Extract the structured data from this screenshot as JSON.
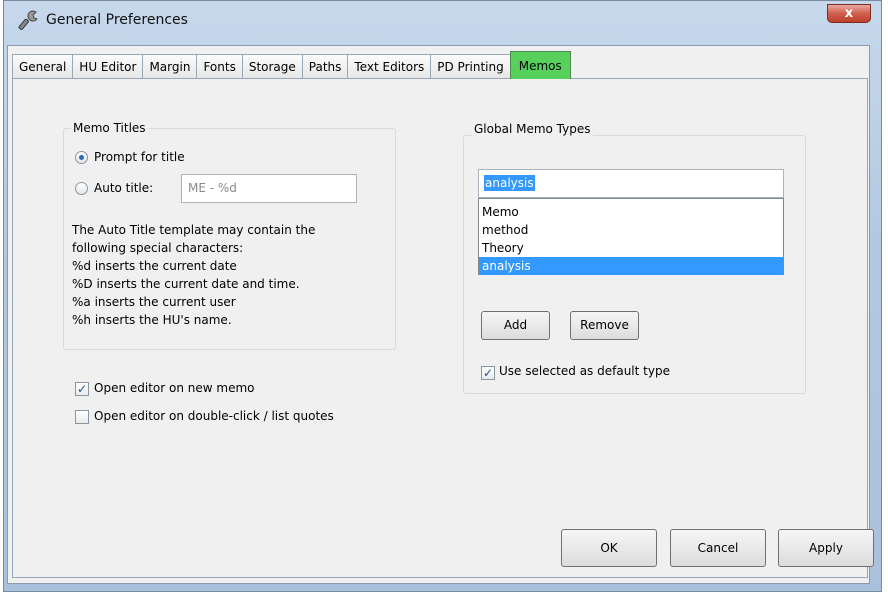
{
  "window": {
    "title": "General Preferences",
    "close_label": "x"
  },
  "tabs": [
    {
      "label": "General"
    },
    {
      "label": "HU Editor"
    },
    {
      "label": "Margin"
    },
    {
      "label": "Fonts"
    },
    {
      "label": "Storage"
    },
    {
      "label": "Paths"
    },
    {
      "label": "Text Editors"
    },
    {
      "label": "PD Printing"
    },
    {
      "label": "Memos",
      "active": true
    }
  ],
  "memo_titles": {
    "group_label": "Memo Titles",
    "prompt_label": "Prompt for title",
    "prompt_selected": true,
    "auto_label": "Auto title:",
    "auto_selected": false,
    "auto_value": "ME - %d",
    "help_lines": [
      "The Auto Title template may contain the",
      "following special characters:",
      "%d inserts the current date",
      "%D inserts the current date and time.",
      "%a inserts the current user",
      "%h inserts the HU's name."
    ]
  },
  "options": {
    "open_editor_new": {
      "label": "Open editor on new memo",
      "checked": true
    },
    "open_editor_dblclick": {
      "label": "Open editor on double-click / list quotes",
      "checked": false
    }
  },
  "global_memo_types": {
    "group_label": "Global Memo Types",
    "input_value": "analysis",
    "items": [
      {
        "label": "Memo",
        "selected": false
      },
      {
        "label": "method",
        "selected": false
      },
      {
        "label": "Theory",
        "selected": false
      },
      {
        "label": "analysis",
        "selected": true
      }
    ],
    "add_label": "Add",
    "remove_label": "Remove",
    "use_default": {
      "label": "Use selected as default type",
      "checked": true
    }
  },
  "buttons": {
    "ok": "OK",
    "cancel": "Cancel",
    "apply": "Apply"
  },
  "colors": {
    "active_tab": "#57d05c",
    "selection": "#3399ff",
    "close": "#c7503c"
  }
}
